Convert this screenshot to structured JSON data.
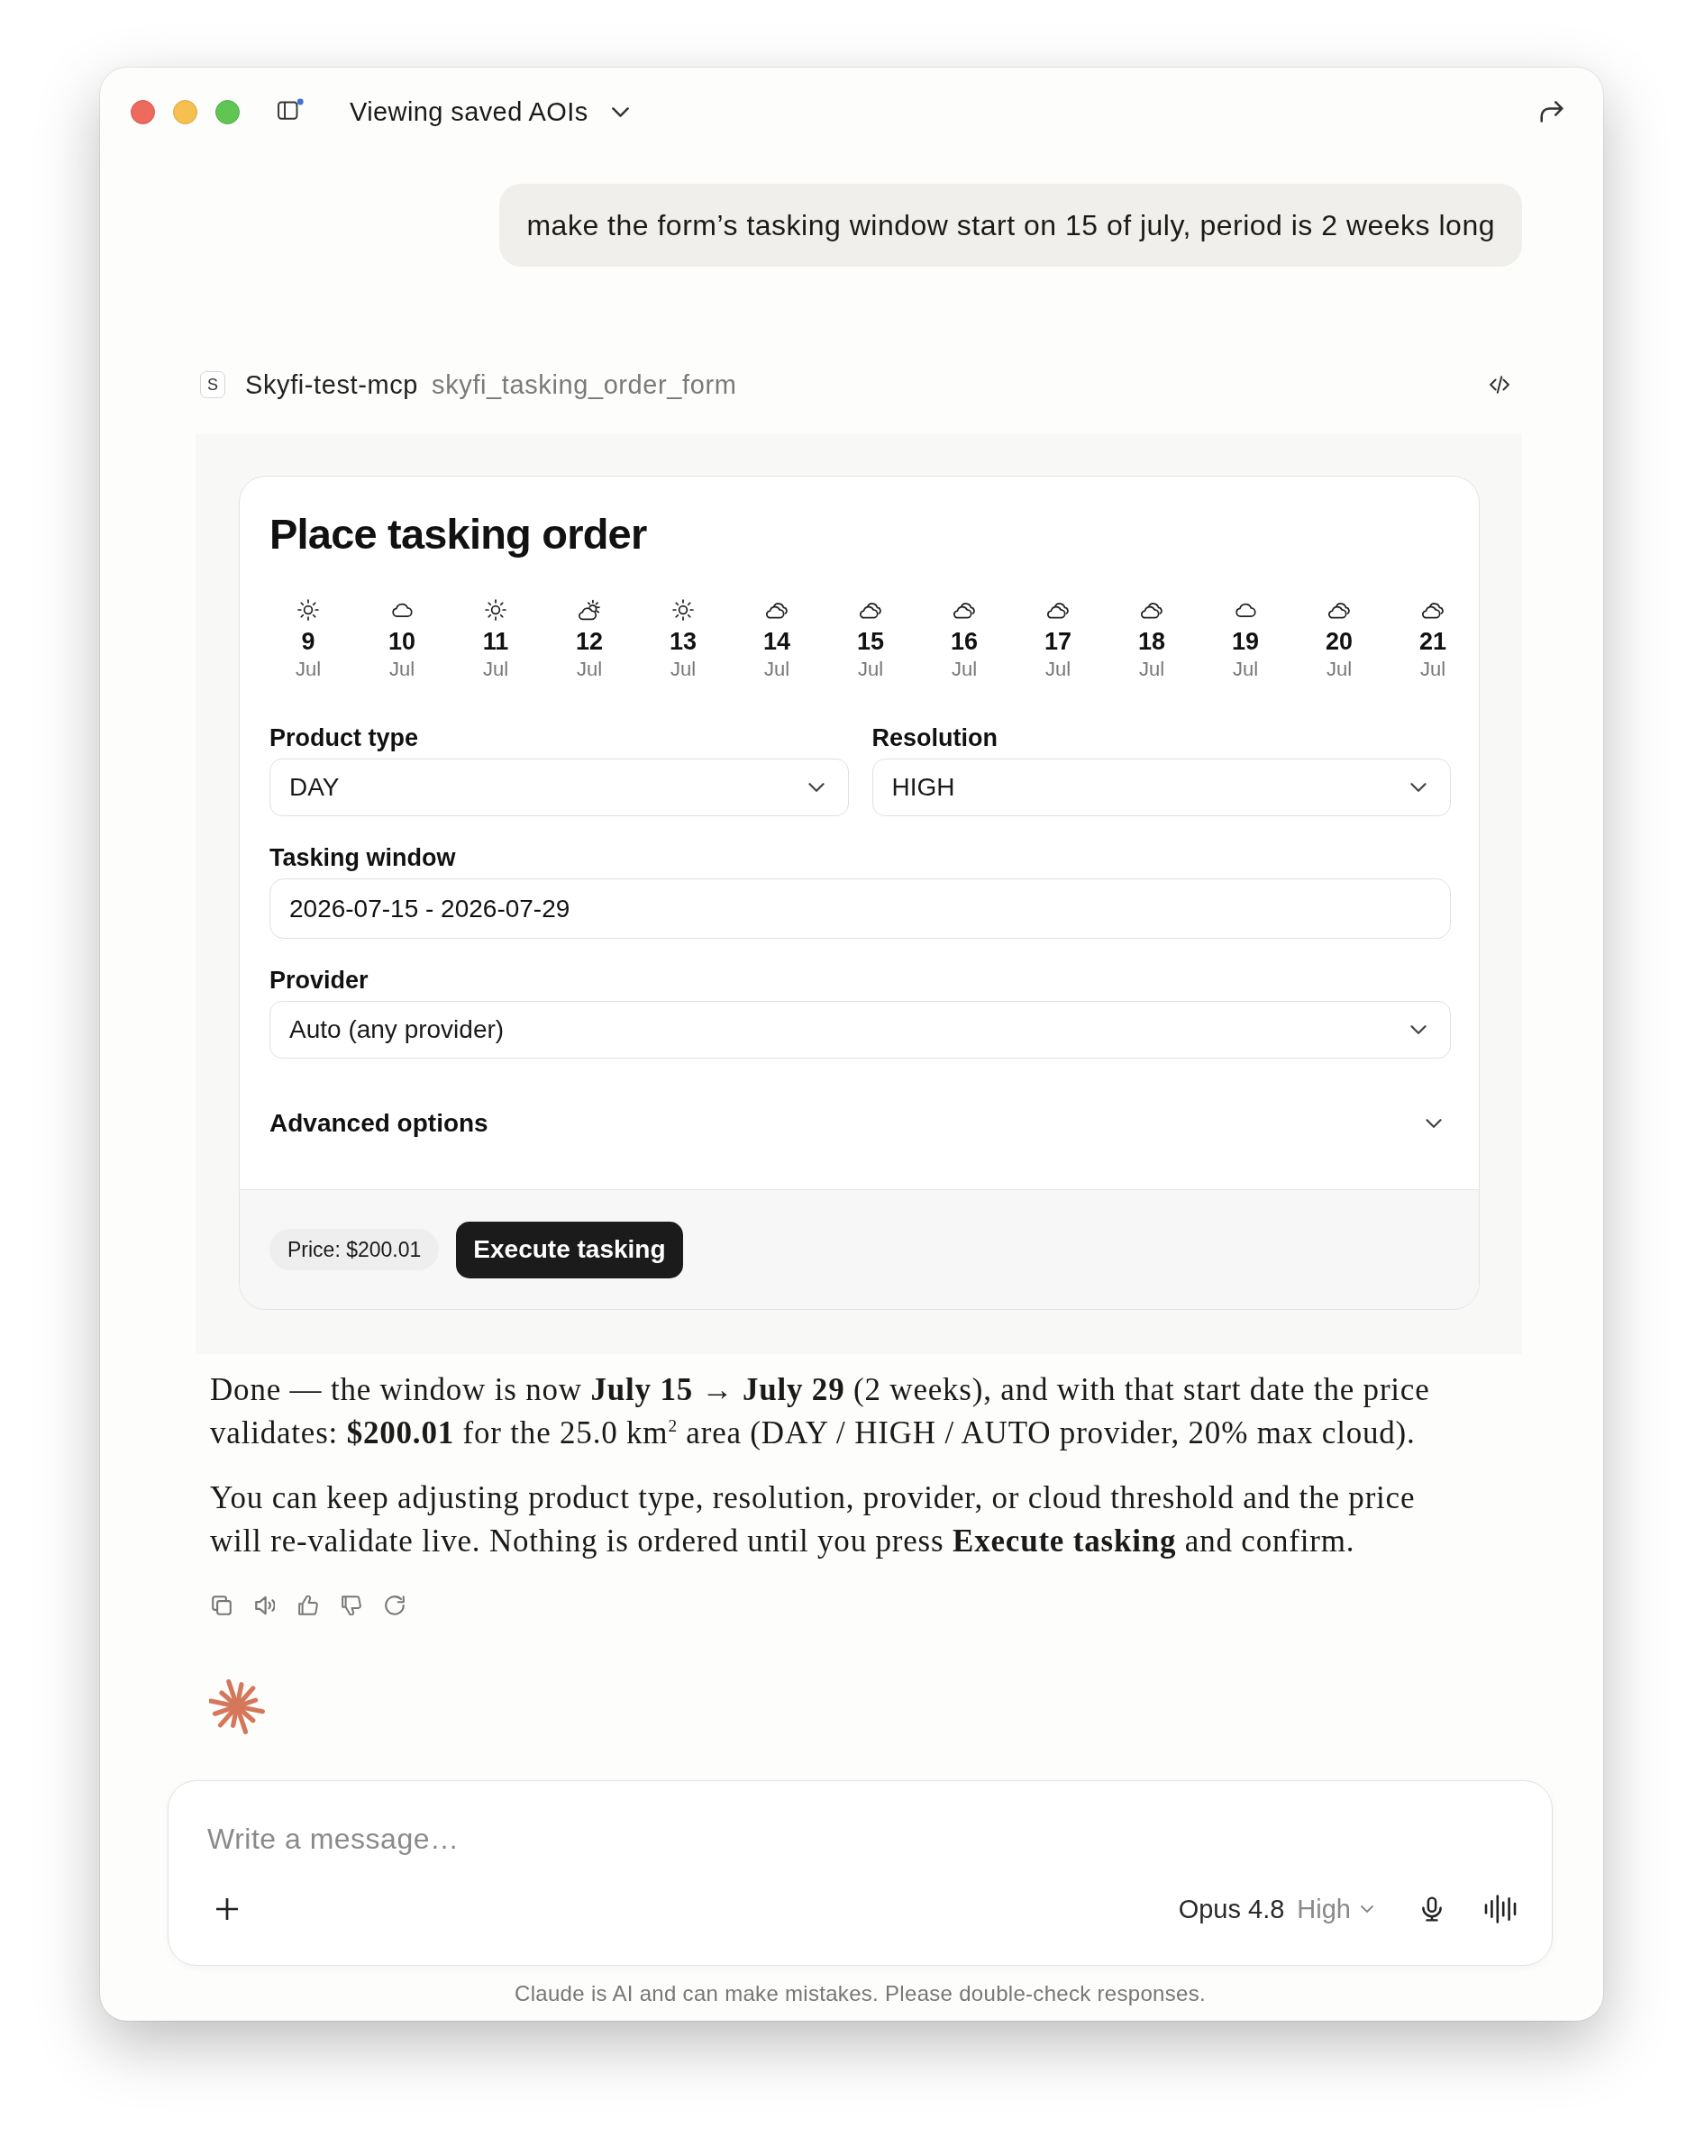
{
  "window": {
    "title": "Viewing saved AOIs"
  },
  "user_message": {
    "text": "make the form’s tasking window start on 15 of july, period is 2 weeks long"
  },
  "tool_call": {
    "badge": "S",
    "server": "Skyfi-test-mcp",
    "tool": "skyfi_tasking_order_form"
  },
  "form": {
    "title": "Place tasking order",
    "forecast": [
      {
        "day": "9",
        "month": "Jul",
        "kind": "sun"
      },
      {
        "day": "10",
        "month": "Jul",
        "kind": "cloud"
      },
      {
        "day": "11",
        "month": "Jul",
        "kind": "sun"
      },
      {
        "day": "12",
        "month": "Jul",
        "kind": "partly"
      },
      {
        "day": "13",
        "month": "Jul",
        "kind": "sun"
      },
      {
        "day": "14",
        "month": "Jul",
        "kind": "clouds"
      },
      {
        "day": "15",
        "month": "Jul",
        "kind": "clouds"
      },
      {
        "day": "16",
        "month": "Jul",
        "kind": "clouds"
      },
      {
        "day": "17",
        "month": "Jul",
        "kind": "clouds"
      },
      {
        "day": "18",
        "month": "Jul",
        "kind": "clouds"
      },
      {
        "day": "19",
        "month": "Jul",
        "kind": "cloud"
      },
      {
        "day": "20",
        "month": "Jul",
        "kind": "clouds"
      },
      {
        "day": "21",
        "month": "Jul",
        "kind": "clouds"
      }
    ],
    "rows": [
      {
        "fields": [
          {
            "kind": "select",
            "label": "Product type",
            "value": "DAY"
          },
          {
            "kind": "select",
            "label": "Resolution",
            "value": "HIGH"
          }
        ]
      },
      {
        "fields": [
          {
            "kind": "text",
            "label": "Tasking window",
            "value": "2026-07-15 - 2026-07-29"
          }
        ]
      },
      {
        "fields": [
          {
            "kind": "select",
            "label": "Provider",
            "value": "Auto (any provider)"
          }
        ]
      }
    ],
    "advanced": {
      "label": "Advanced options",
      "expanded": false
    },
    "price": "Price: $200.01",
    "submit": "Execute tasking"
  },
  "response": {
    "paragraphs": [
      "Done — the window is now **July 15 → July 29** (2 weeks), and with that start date the price validates: **$200.01** for the 25.0 km$^{2}$ area (DAY / HIGH / AUTO provider, 20% max cloud).",
      "You can keep adjusting product type, resolution, provider, or cloud threshold and the price will re-validate live. Nothing is ordered until you press **Execute tasking** and confirm."
    ]
  },
  "composer": {
    "placeholder": "Write a message…",
    "model": "Opus 4.8",
    "effort": "High"
  },
  "disclaimer": "Claude is AI and can make mistakes. Please double-check responses."
}
